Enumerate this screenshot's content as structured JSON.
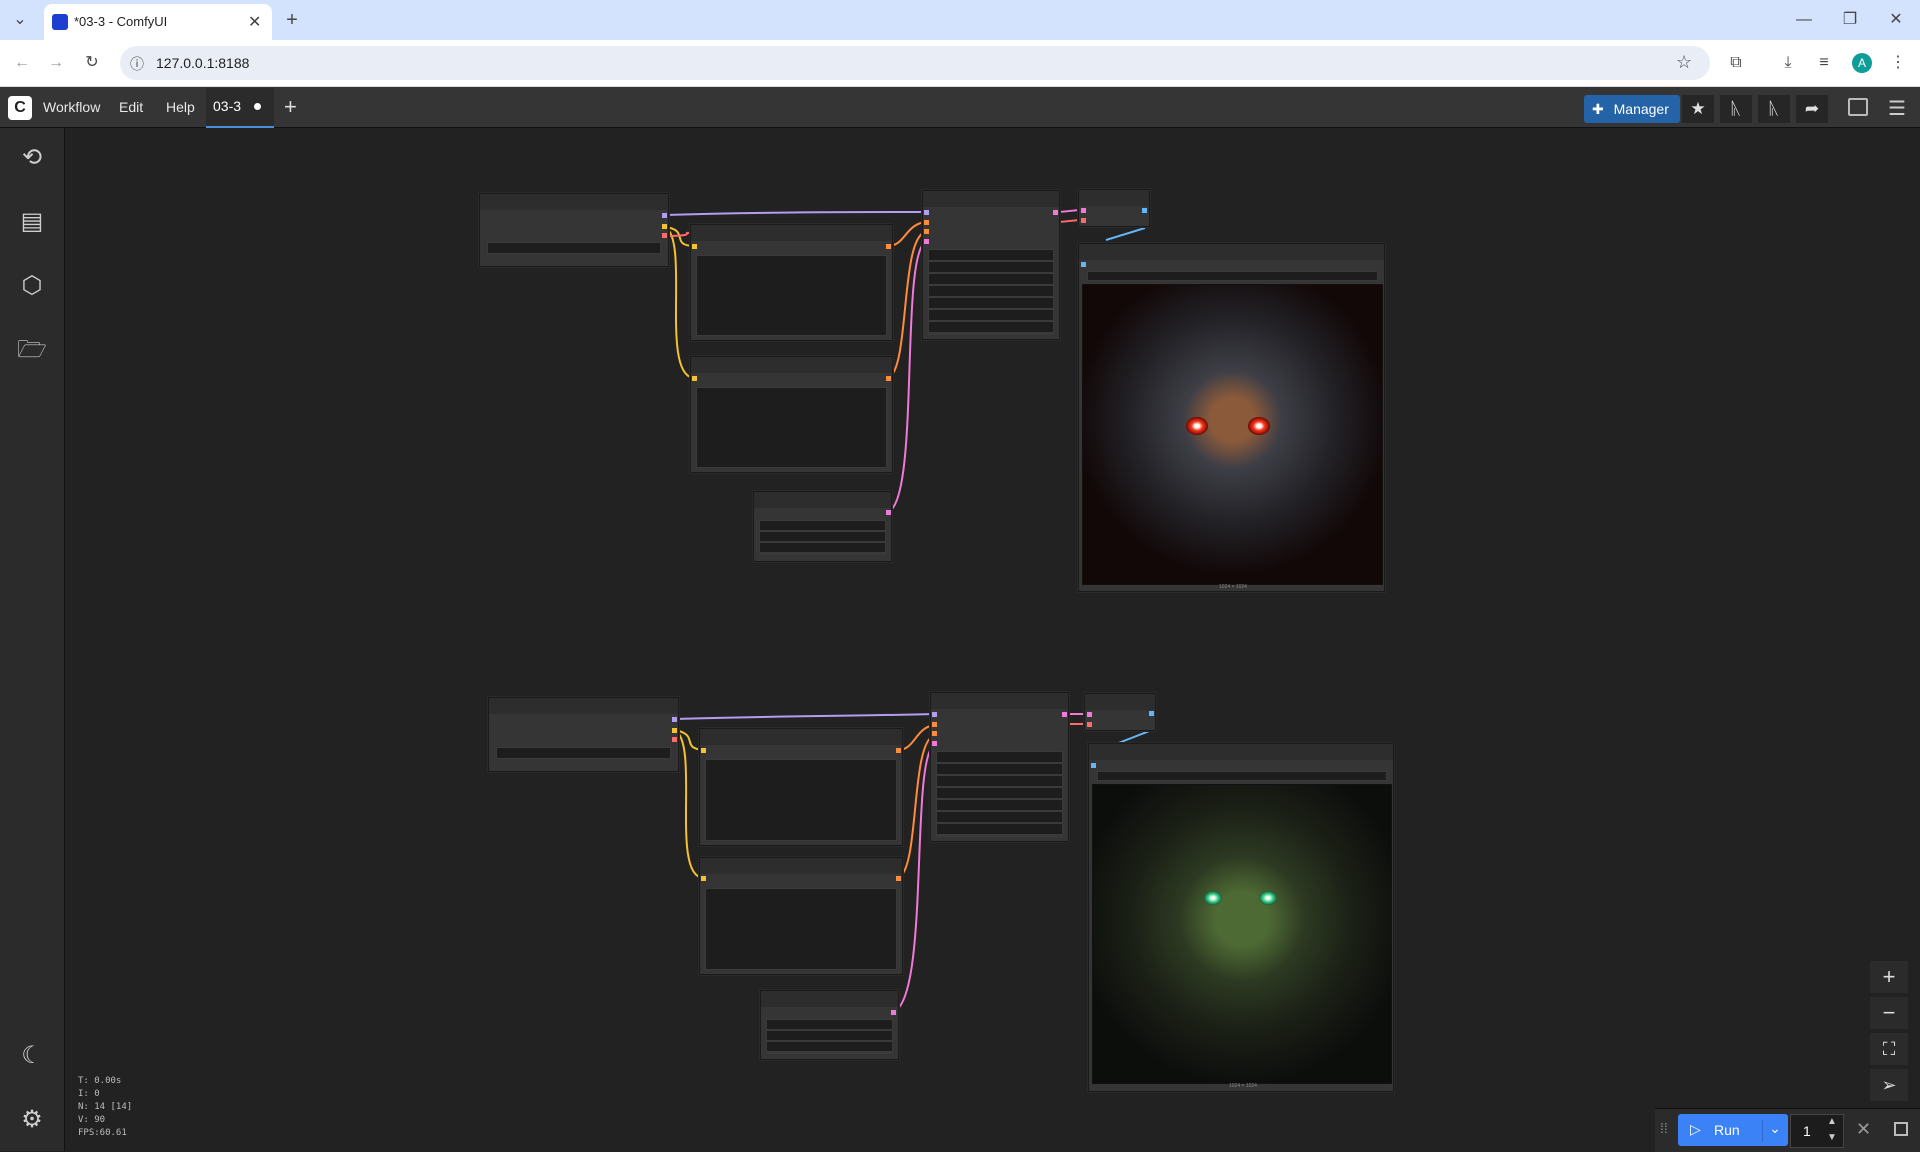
{
  "browser": {
    "tab_title": "*03-3 - ComfyUI",
    "url": "127.0.0.1:8188",
    "profile_initial": "A"
  },
  "appbar": {
    "menus": [
      "Workflow",
      "Edit",
      "Help"
    ],
    "workflow_tab": "03-3",
    "manager_label": "Manager"
  },
  "canvas": {
    "image_caption_top": "1024 × 1024",
    "image_caption_bottom": "1024 × 1024"
  },
  "stats": {
    "t": "T: 0.00s",
    "i": "I: 0",
    "n": "N: 14 [14]",
    "v": "V: 90",
    "fps": "FPS:60.61"
  },
  "runbar": {
    "run_label": "Run",
    "batch_count": "1"
  },
  "colors": {
    "link_yellow": "#f3c22e",
    "link_orange": "#ff8c3a",
    "link_lavender": "#b49cf0",
    "link_pink": "#f07ad8",
    "link_red": "#ff6b6b",
    "link_blue": "#64b5f6",
    "accent": "#3b82f6"
  }
}
